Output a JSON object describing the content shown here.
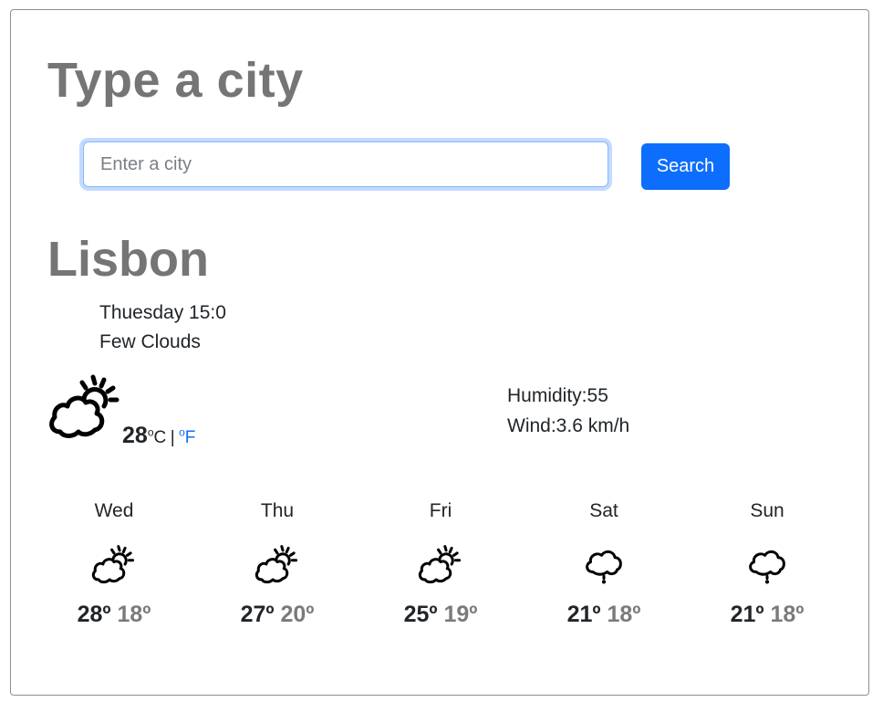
{
  "heading": "Type a city",
  "search": {
    "placeholder": "Enter a city",
    "button_label": "Search"
  },
  "current": {
    "city": "Lisbon",
    "datetime": "Thuesday 15:0",
    "description": "Few Clouds",
    "icon": "few-clouds-icon",
    "temperature": "28",
    "unit_c": "C",
    "unit_separator": "|",
    "unit_f": "F",
    "degree_symbol": "o",
    "humidity": "Humidity:55",
    "wind": "Wind:3.6 km/h"
  },
  "forecast": [
    {
      "day": "Wed",
      "icon": "few-clouds-icon",
      "max": "28º",
      "min": "18º"
    },
    {
      "day": "Thu",
      "icon": "few-clouds-icon",
      "max": "27º",
      "min": "20º"
    },
    {
      "day": "Fri",
      "icon": "few-clouds-icon",
      "max": "25º",
      "min": "19º"
    },
    {
      "day": "Sat",
      "icon": "rain-cloud-icon",
      "max": "21º",
      "min": "18º"
    },
    {
      "day": "Sun",
      "icon": "rain-cloud-icon",
      "max": "21º",
      "min": "18º"
    }
  ],
  "colors": {
    "accent": "#0d6efd",
    "heading": "#757575",
    "muted_temp": "#7a7a7a"
  }
}
